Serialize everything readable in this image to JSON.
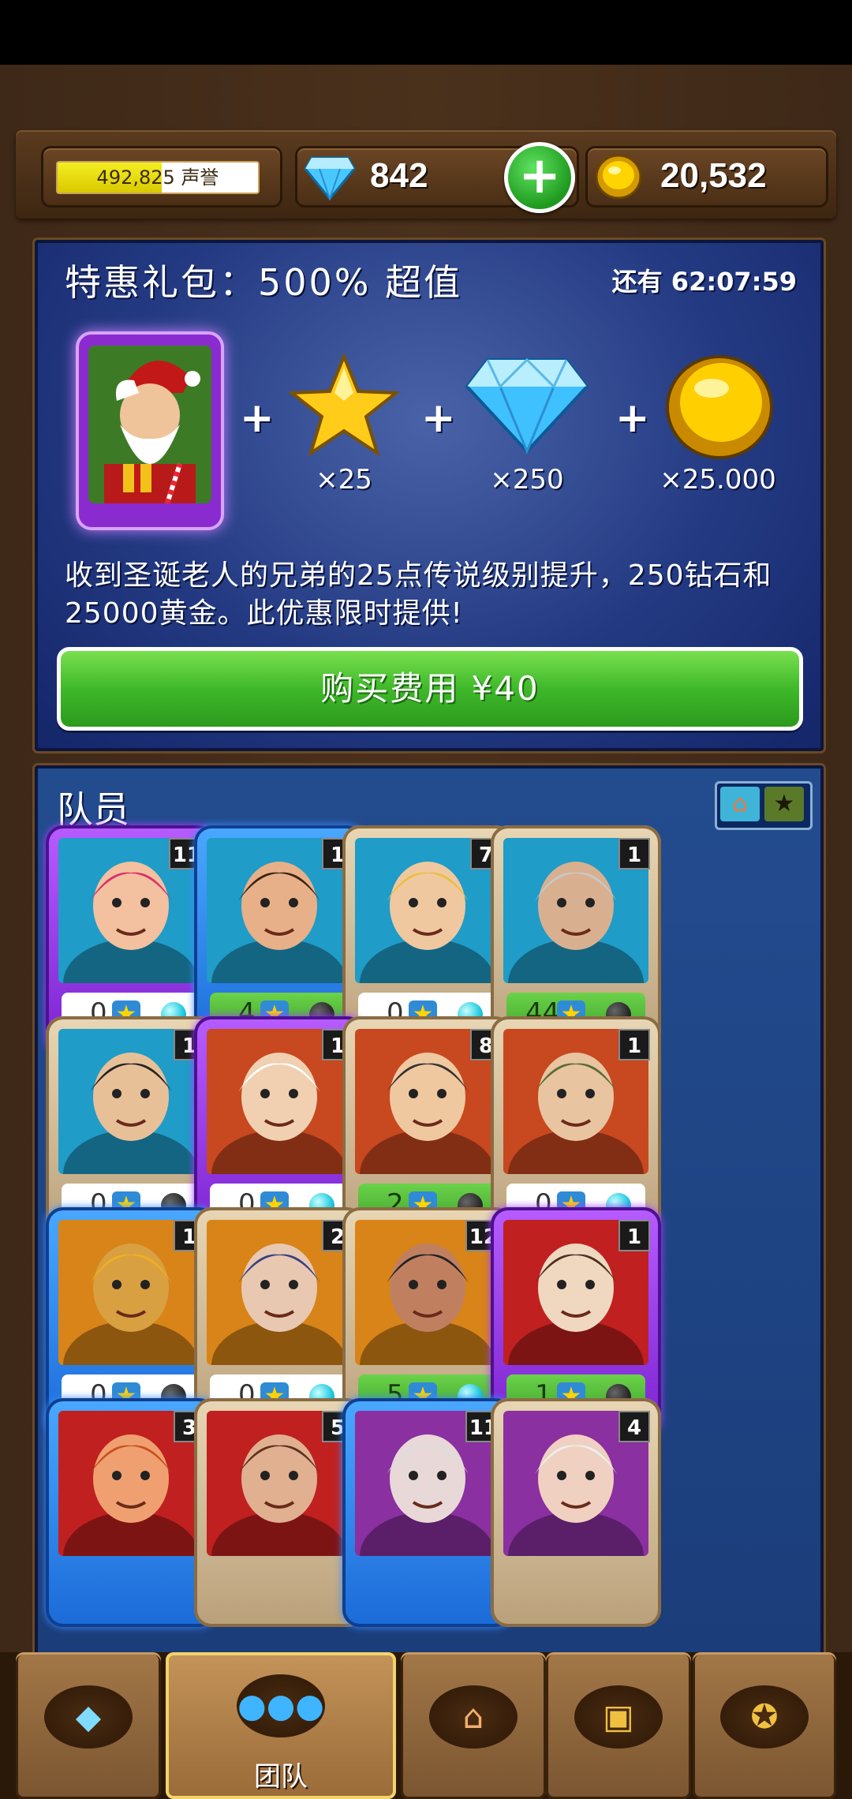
{
  "resources": {
    "reputation_value": "492,825",
    "reputation_label": "声誉",
    "reputation_progress": 0.52,
    "gems": "842",
    "gold": "20,532"
  },
  "offer": {
    "title": "特惠礼包：500% 超值",
    "timer": "还有 62:07:59",
    "rewards": [
      {
        "icon": "star-icon",
        "qty": "×25"
      },
      {
        "icon": "diamond-icon",
        "qty": "×250"
      },
      {
        "icon": "coin-icon",
        "qty": "×25.000"
      }
    ],
    "description": "收到圣诞老人的兄弟的25点传说级别提升，250钻石和25000黄金。此优惠限时提供!",
    "buy_label": "购买费用 ¥40"
  },
  "team": {
    "title": "队员",
    "members": [
      {
        "level": "11",
        "stars": "0",
        "rarity": "purple",
        "boosted": false,
        "orb": "cyan"
      },
      {
        "level": "1",
        "stars": "4",
        "rarity": "blue",
        "boosted": true,
        "orb": "dark"
      },
      {
        "level": "7",
        "stars": "0",
        "rarity": "tan",
        "boosted": false,
        "orb": "cyan"
      },
      {
        "level": "1",
        "stars": "44",
        "rarity": "tan",
        "boosted": true,
        "orb": "dark"
      },
      {
        "level": "1",
        "stars": "0",
        "rarity": "tan",
        "boosted": false,
        "orb": "dark"
      },
      {
        "level": "1",
        "stars": "0",
        "rarity": "purple",
        "boosted": false,
        "orb": "cyan"
      },
      {
        "level": "8",
        "stars": "2",
        "rarity": "tan",
        "boosted": true,
        "orb": "dark"
      },
      {
        "level": "1",
        "stars": "0",
        "rarity": "tan",
        "boosted": false,
        "orb": "cyan"
      },
      {
        "level": "1",
        "stars": "0",
        "rarity": "blue",
        "boosted": false,
        "orb": "dark"
      },
      {
        "level": "2",
        "stars": "0",
        "rarity": "tan",
        "boosted": false,
        "orb": "cyan"
      },
      {
        "level": "12",
        "stars": "5",
        "rarity": "tan",
        "boosted": true,
        "orb": "cyan"
      },
      {
        "level": "1",
        "stars": "1",
        "rarity": "purple",
        "boosted": true,
        "orb": "dark"
      },
      {
        "level": "3",
        "stars": "",
        "rarity": "blue",
        "boosted": false,
        "orb": ""
      },
      {
        "level": "5",
        "stars": "",
        "rarity": "tan",
        "boosted": false,
        "orb": ""
      },
      {
        "level": "11",
        "stars": "",
        "rarity": "blue",
        "boosted": false,
        "orb": ""
      },
      {
        "level": "4",
        "stars": "",
        "rarity": "tan",
        "boosted": false,
        "orb": ""
      }
    ]
  },
  "nav": {
    "tabs": [
      {
        "icon": "gems-icon",
        "label": ""
      },
      {
        "icon": "team-icon",
        "label": "团队"
      },
      {
        "icon": "town-icon",
        "label": ""
      },
      {
        "icon": "chest-icon",
        "label": ""
      },
      {
        "icon": "medal-icon",
        "label": ""
      }
    ],
    "active_index": 1
  },
  "colors": {
    "panel_blue": "#1b3d7a",
    "buy_green": "#3fb82a",
    "reputation_yellow": "#f4ee22"
  }
}
